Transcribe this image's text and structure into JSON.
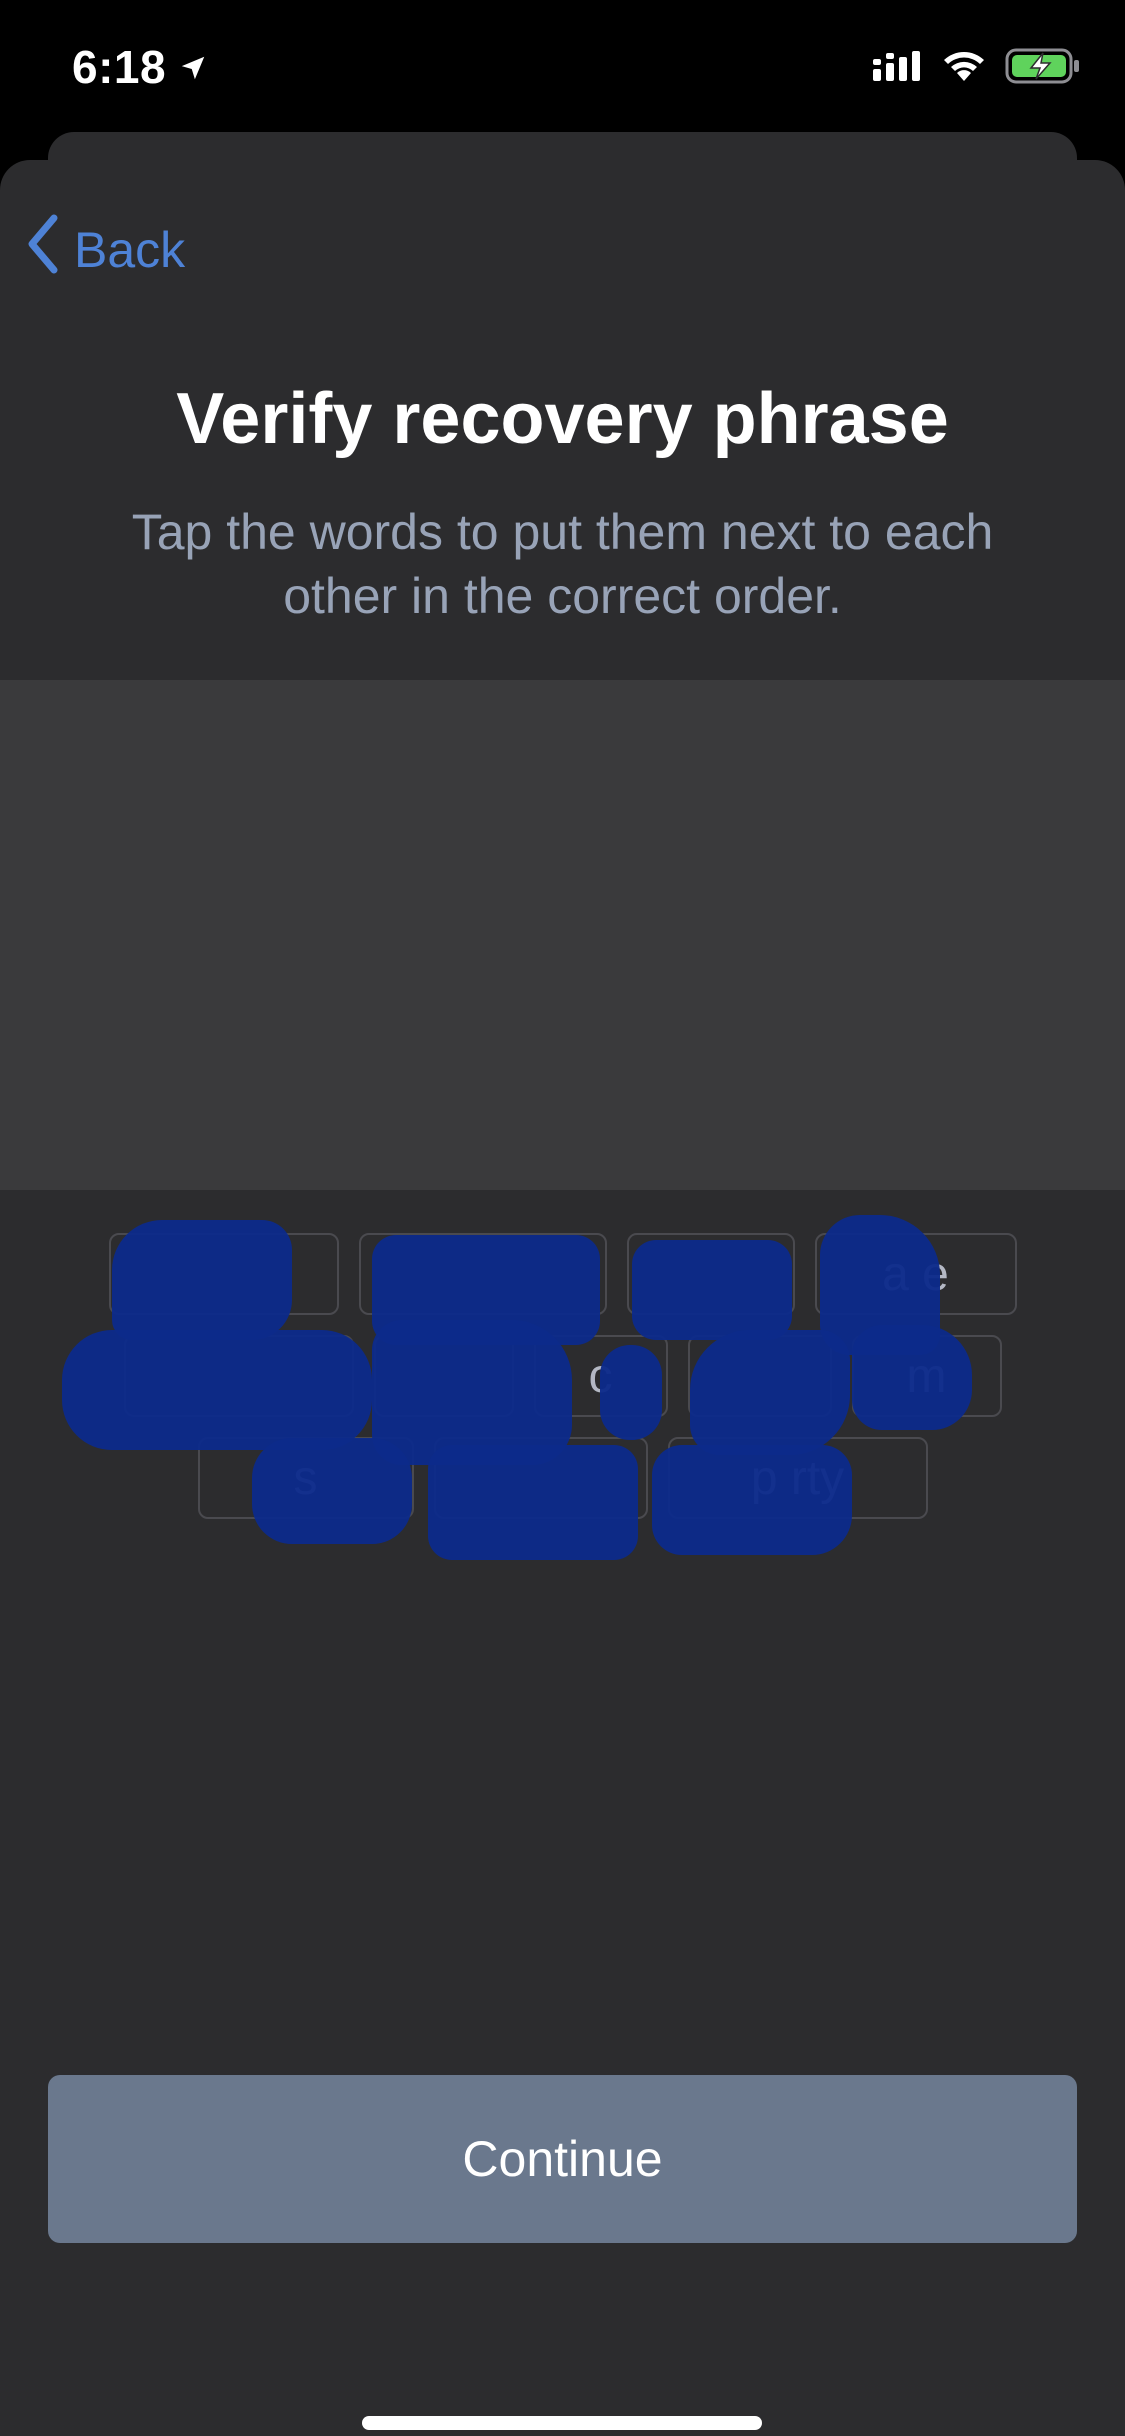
{
  "status_bar": {
    "time": "6:18",
    "location_icon": "location-arrow-icon",
    "signal_icon": "cellular-signal-icon",
    "wifi_icon": "wifi-icon",
    "battery_icon": "battery-charging-icon",
    "battery_color": "#5fd35c"
  },
  "nav": {
    "back_label": "Back",
    "back_icon": "chevron-left-icon",
    "accent_color": "#4e82d6"
  },
  "header": {
    "title": "Verify recovery phrase",
    "subtitle": "Tap the words to put them next to each other in the correct order."
  },
  "word_bank": {
    "rows": [
      {
        "words": [
          "",
          "",
          "",
          "a   e"
        ]
      },
      {
        "words": [
          "",
          "",
          "c",
          "",
          "m"
        ]
      },
      {
        "words": [
          "s",
          "",
          "p      rty"
        ]
      }
    ],
    "redaction_color": "#0c2b8a"
  },
  "footer": {
    "continue_label": "Continue",
    "continue_color": "#6a788d"
  }
}
